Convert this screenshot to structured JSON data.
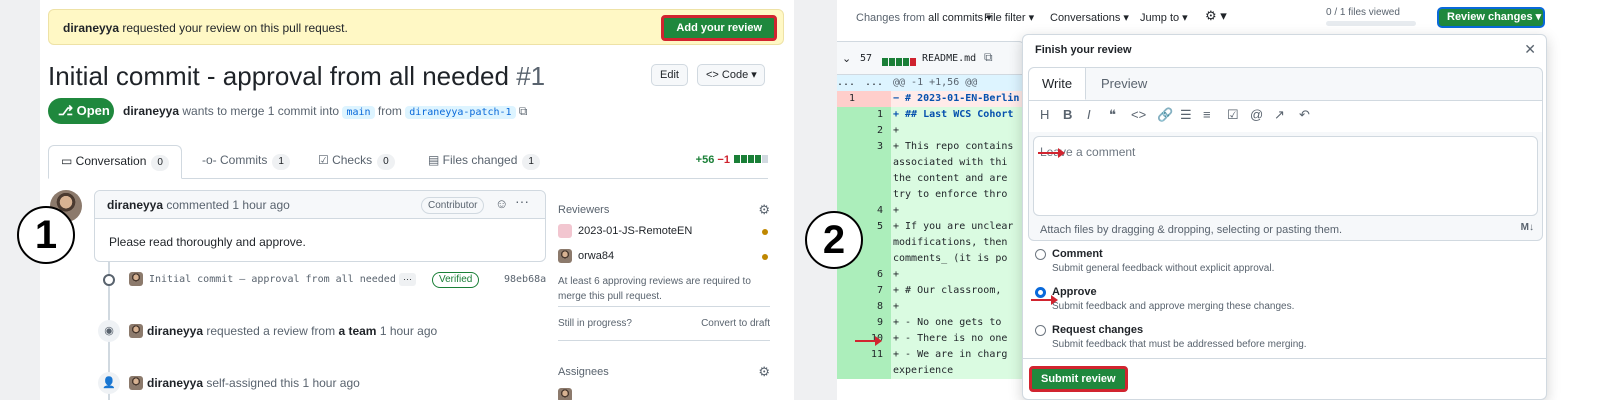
{
  "panel1": {
    "banner": {
      "user": "diraneyya",
      "text": " requested your review on this pull request.",
      "button": "Add your review"
    },
    "title": "Initial commit - approval from all needed",
    "pr_number": "#1",
    "edit_label": "Edit",
    "code_label": "<> Code ▾",
    "status": "Open",
    "merge": {
      "user": "diraneyya",
      "text_a": " wants to merge 1 commit into ",
      "base": "main",
      "text_b": " from ",
      "head": "diraneyya-patch-1"
    },
    "tabs": [
      {
        "label": "Conversation",
        "count": "0"
      },
      {
        "label": "Commits",
        "count": "1"
      },
      {
        "label": "Checks",
        "count": "0"
      },
      {
        "label": "Files changed",
        "count": "1"
      }
    ],
    "diffstat": {
      "add": "+56",
      "del": "−1"
    },
    "comment": {
      "user": "diraneyya",
      "meta": " commented 1 hour ago",
      "role": "Contributor",
      "body": "Please read thoroughly and approve."
    },
    "commit": {
      "message": "Initial commit – approval from all needed",
      "ellipsis": "···",
      "verified": "Verified",
      "sha": "98eb68a"
    },
    "events": [
      {
        "user": "diraneyya",
        "text_a": " requested a review from ",
        "target": "a team",
        "text_b": " 1 hour ago"
      },
      {
        "user": "diraneyya",
        "text_a": " self-assigned this ",
        "target": "",
        "text_b": "1 hour ago"
      }
    ],
    "sidebar": {
      "reviewers_title": "Reviewers",
      "reviewers": [
        "2023-01-JS-RemoteEN",
        "orwa84"
      ],
      "note": "At least 6 approving reviews are required to merge this pull request.",
      "still": "Still in progress?",
      "draft": "Convert to draft",
      "assignees_title": "Assignees"
    },
    "step": "1"
  },
  "panel2": {
    "topbar": {
      "changes_prefix": "Changes from ",
      "changes_value": "all commits ▾",
      "file_filter": "File filter ▾",
      "conversations": "Conversations ▾",
      "jump": "Jump to ▾",
      "viewed": "0 / 1 files viewed",
      "review_button": "Review changes ▾"
    },
    "file": {
      "changes": "57",
      "name": "README.md"
    },
    "code_lines": [
      {
        "l": "...",
        "r": "...",
        "t": "@@ -1 +1,56 @@",
        "k": "hunk"
      },
      {
        "l": "1",
        "r": "",
        "t": "− # 2023-01-EN-Berlin",
        "k": "del"
      },
      {
        "l": "",
        "r": "1",
        "t": "+ ## Last WCS Cohort",
        "k": "add"
      },
      {
        "l": "",
        "r": "2",
        "t": "+",
        "k": "add"
      },
      {
        "l": "",
        "r": "3",
        "t": "+ This repo contains",
        "k": "add"
      },
      {
        "l": "",
        "r": "",
        "t": "  associated with thi",
        "k": "add"
      },
      {
        "l": "",
        "r": "",
        "t": "  the content and are",
        "k": "add"
      },
      {
        "l": "",
        "r": "",
        "t": "  try to enforce thro",
        "k": "add"
      },
      {
        "l": "",
        "r": "4",
        "t": "+",
        "k": "add"
      },
      {
        "l": "",
        "r": "5",
        "t": "+ If you are unclear",
        "k": "add"
      },
      {
        "l": "",
        "r": "",
        "t": "  modifications, then",
        "k": "add"
      },
      {
        "l": "",
        "r": "",
        "t": "  comments_ (it is po",
        "k": "add"
      },
      {
        "l": "",
        "r": "6",
        "t": "+",
        "k": "add"
      },
      {
        "l": "",
        "r": "7",
        "t": "+  # Our classroom,",
        "k": "add"
      },
      {
        "l": "",
        "r": "8",
        "t": "+",
        "k": "add"
      },
      {
        "l": "",
        "r": "9",
        "t": "+  - No one gets to",
        "k": "add"
      },
      {
        "l": "",
        "r": "10",
        "t": "+  - There is no one",
        "k": "add"
      },
      {
        "l": "",
        "r": "11",
        "t": "+  - We are in charg",
        "k": "add"
      },
      {
        "l": "",
        "r": "",
        "t": "  experience",
        "k": "add"
      }
    ],
    "dialog": {
      "title": "Finish your review",
      "tab_write": "Write",
      "tab_preview": "Preview",
      "placeholder": "Leave a comment",
      "attach": "Attach files by dragging & dropping, selecting or pasting them.",
      "options": [
        {
          "label": "Comment",
          "desc": "Submit general feedback without explicit approval."
        },
        {
          "label": "Approve",
          "desc": "Submit feedback and approve merging these changes."
        },
        {
          "label": "Request changes",
          "desc": "Submit feedback that must be addressed before merging."
        }
      ],
      "submit": "Submit review"
    },
    "step": "2"
  }
}
